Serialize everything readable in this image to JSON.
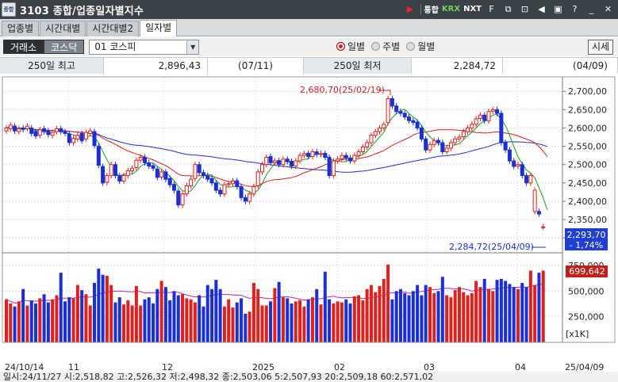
{
  "window": {
    "logo": "종합",
    "title": "3103  종합/업종일자별지수",
    "controls": [
      "통합",
      "KRX",
      "NXT"
    ],
    "icons": [
      "play-icon",
      "font-icon",
      "link-icon",
      "lock-icon",
      "prev-icon",
      "restore-icon",
      "help-icon",
      "minimize-icon",
      "close-icon"
    ]
  },
  "tabs": [
    {
      "label": "업종별",
      "active": false
    },
    {
      "label": "시간대별",
      "active": false
    },
    {
      "label": "시간대별2",
      "active": false
    },
    {
      "label": "일자별",
      "active": true
    }
  ],
  "toolbar": {
    "exchange_on": "거래소",
    "exchange_off": "코스닥",
    "index_select": "01  코스피",
    "radios": [
      {
        "label": "일별",
        "checked": true
      },
      {
        "label": "주별",
        "checked": false
      },
      {
        "label": "월별",
        "checked": false
      }
    ],
    "quote_button": "시세"
  },
  "stats": {
    "high_label": "250일 최고",
    "high_value": "2,896,43",
    "high_date": "(07/11)",
    "low_label": "250일 최저",
    "low_value": "2,284,72",
    "low_date": "(04/09)"
  },
  "chart": {
    "price_ticks": [
      "2,700,00",
      "2,650,00",
      "2,600,00",
      "2,550,00",
      "2,500,00",
      "2,450,00",
      "2,400,00",
      "2,350,00",
      "2,300,00"
    ],
    "current_price": "2,293,70",
    "current_change": "- 1,74%",
    "high_annotation": "2,680,70(25/02/19)",
    "low_annotation": "2,284,72(25/04/09)",
    "volume_ticks": [
      "750,000",
      "500,000",
      "250,000"
    ],
    "volume_current": "699,642",
    "volume_unit": "[x1K]",
    "x_labels": [
      "24/10/14",
      "11",
      "12",
      "2025",
      "02",
      "03",
      "04",
      "25/04/09"
    ],
    "status_line": "일시:24/11/27 시:2,518,82 고:2,526,32 저:2,498,32 종:2,503,06 5:2,507,93 20:2,509,18 60:2,571,02",
    "colors": {
      "up": "#e0201c",
      "down": "#1a2fd6",
      "ma5": "#1a9e1a",
      "ma20": "#d8201a",
      "ma60": "#1a2fd6",
      "vol_ma": "#c020c0"
    }
  },
  "chart_data": {
    "type": "candlestick",
    "price_range": [
      2270,
      2720
    ],
    "volume_range": [
      0,
      820000
    ],
    "series_close": [
      2600,
      2608,
      2592,
      2598,
      2596,
      2605,
      2585,
      2578,
      2595,
      2590,
      2582,
      2588,
      2598,
      2590,
      2585,
      2560,
      2572,
      2580,
      2565,
      2588,
      2592,
      2552,
      2498,
      2450,
      2470,
      2500,
      2470,
      2455,
      2470,
      2483,
      2490,
      2512,
      2520,
      2505,
      2496,
      2490,
      2465,
      2480,
      2460,
      2445,
      2430,
      2390,
      2420,
      2442,
      2460,
      2500,
      2478,
      2470,
      2460,
      2450,
      2430,
      2420,
      2445,
      2448,
      2455,
      2440,
      2410,
      2400,
      2420,
      2440,
      2480,
      2500,
      2520,
      2505,
      2510,
      2500,
      2515,
      2508,
      2496,
      2510,
      2525,
      2530,
      2522,
      2535,
      2528,
      2530,
      2520,
      2470,
      2510,
      2515,
      2525,
      2518,
      2510,
      2525,
      2535,
      2548,
      2560,
      2580,
      2590,
      2600,
      2610,
      2680,
      2660,
      2645,
      2640,
      2630,
      2620,
      2615,
      2600,
      2570,
      2540,
      2555,
      2565,
      2560,
      2535,
      2545,
      2560,
      2570,
      2575,
      2590,
      2600,
      2610,
      2625,
      2635,
      2620,
      2645,
      2650,
      2640,
      2560,
      2540,
      2510,
      2495,
      2500,
      2470,
      2450,
      2470,
      2430,
      2365,
      2330,
      2285
    ],
    "series_open": [
      2592,
      2598,
      2605,
      2590,
      2600,
      2598,
      2600,
      2590,
      2580,
      2598,
      2592,
      2580,
      2590,
      2598,
      2590,
      2584,
      2560,
      2570,
      2585,
      2570,
      2585,
      2590,
      2550,
      2495,
      2452,
      2470,
      2500,
      2470,
      2455,
      2470,
      2483,
      2492,
      2512,
      2520,
      2505,
      2497,
      2488,
      2466,
      2480,
      2462,
      2446,
      2428,
      2390,
      2420,
      2442,
      2462,
      2500,
      2478,
      2470,
      2462,
      2450,
      2430,
      2420,
      2445,
      2448,
      2456,
      2440,
      2410,
      2400,
      2420,
      2442,
      2480,
      2500,
      2522,
      2505,
      2511,
      2500,
      2515,
      2509,
      2496,
      2510,
      2525,
      2531,
      2522,
      2535,
      2528,
      2531,
      2520,
      2470,
      2510,
      2516,
      2525,
      2518,
      2510,
      2525,
      2535,
      2548,
      2560,
      2580,
      2590,
      2600,
      2615,
      2680,
      2660,
      2645,
      2640,
      2630,
      2620,
      2616,
      2600,
      2570,
      2540,
      2555,
      2566,
      2560,
      2535,
      2545,
      2560,
      2570,
      2576,
      2590,
      2600,
      2610,
      2626,
      2635,
      2620,
      2646,
      2650,
      2640,
      2560,
      2540,
      2510,
      2496,
      2500,
      2470,
      2450,
      2372,
      2372,
      2330
    ],
    "volume": [
      420000,
      380000,
      350000,
      400000,
      520000,
      360000,
      410000,
      380000,
      430000,
      470000,
      390000,
      420000,
      460000,
      680000,
      400000,
      440000,
      430000,
      560000,
      510000,
      470000,
      360000,
      580000,
      720000,
      660000,
      650000,
      560000,
      390000,
      440000,
      370000,
      410000,
      360000,
      550000,
      360000,
      420000,
      440000,
      380000,
      520000,
      600000,
      540000,
      410000,
      500000,
      460000,
      470000,
      430000,
      420000,
      390000,
      460000,
      350000,
      560000,
      520000,
      610000,
      520000,
      350000,
      420000,
      340000,
      390000,
      430000,
      280000,
      300000,
      580000,
      520000,
      360000,
      360000,
      400000,
      530000,
      590000,
      440000,
      430000,
      380000,
      400000,
      410000,
      350000,
      420000,
      440000,
      520000,
      370000,
      690000,
      420000,
      380000,
      400000,
      390000,
      420000,
      380000,
      450000,
      460000,
      410000,
      520000,
      560000,
      490000,
      550000,
      620000,
      760000,
      420000,
      500000,
      520000,
      480000,
      460000,
      500000,
      560000,
      460000,
      560000,
      540000,
      480000,
      500000,
      640000,
      460000,
      440000,
      510000,
      540000,
      490000,
      460000,
      480000,
      600000,
      540000,
      620000,
      520000,
      500000,
      610000,
      620000,
      600000,
      570000,
      540000,
      520000,
      580000,
      540000,
      700000,
      560000,
      680000,
      700000
    ]
  }
}
